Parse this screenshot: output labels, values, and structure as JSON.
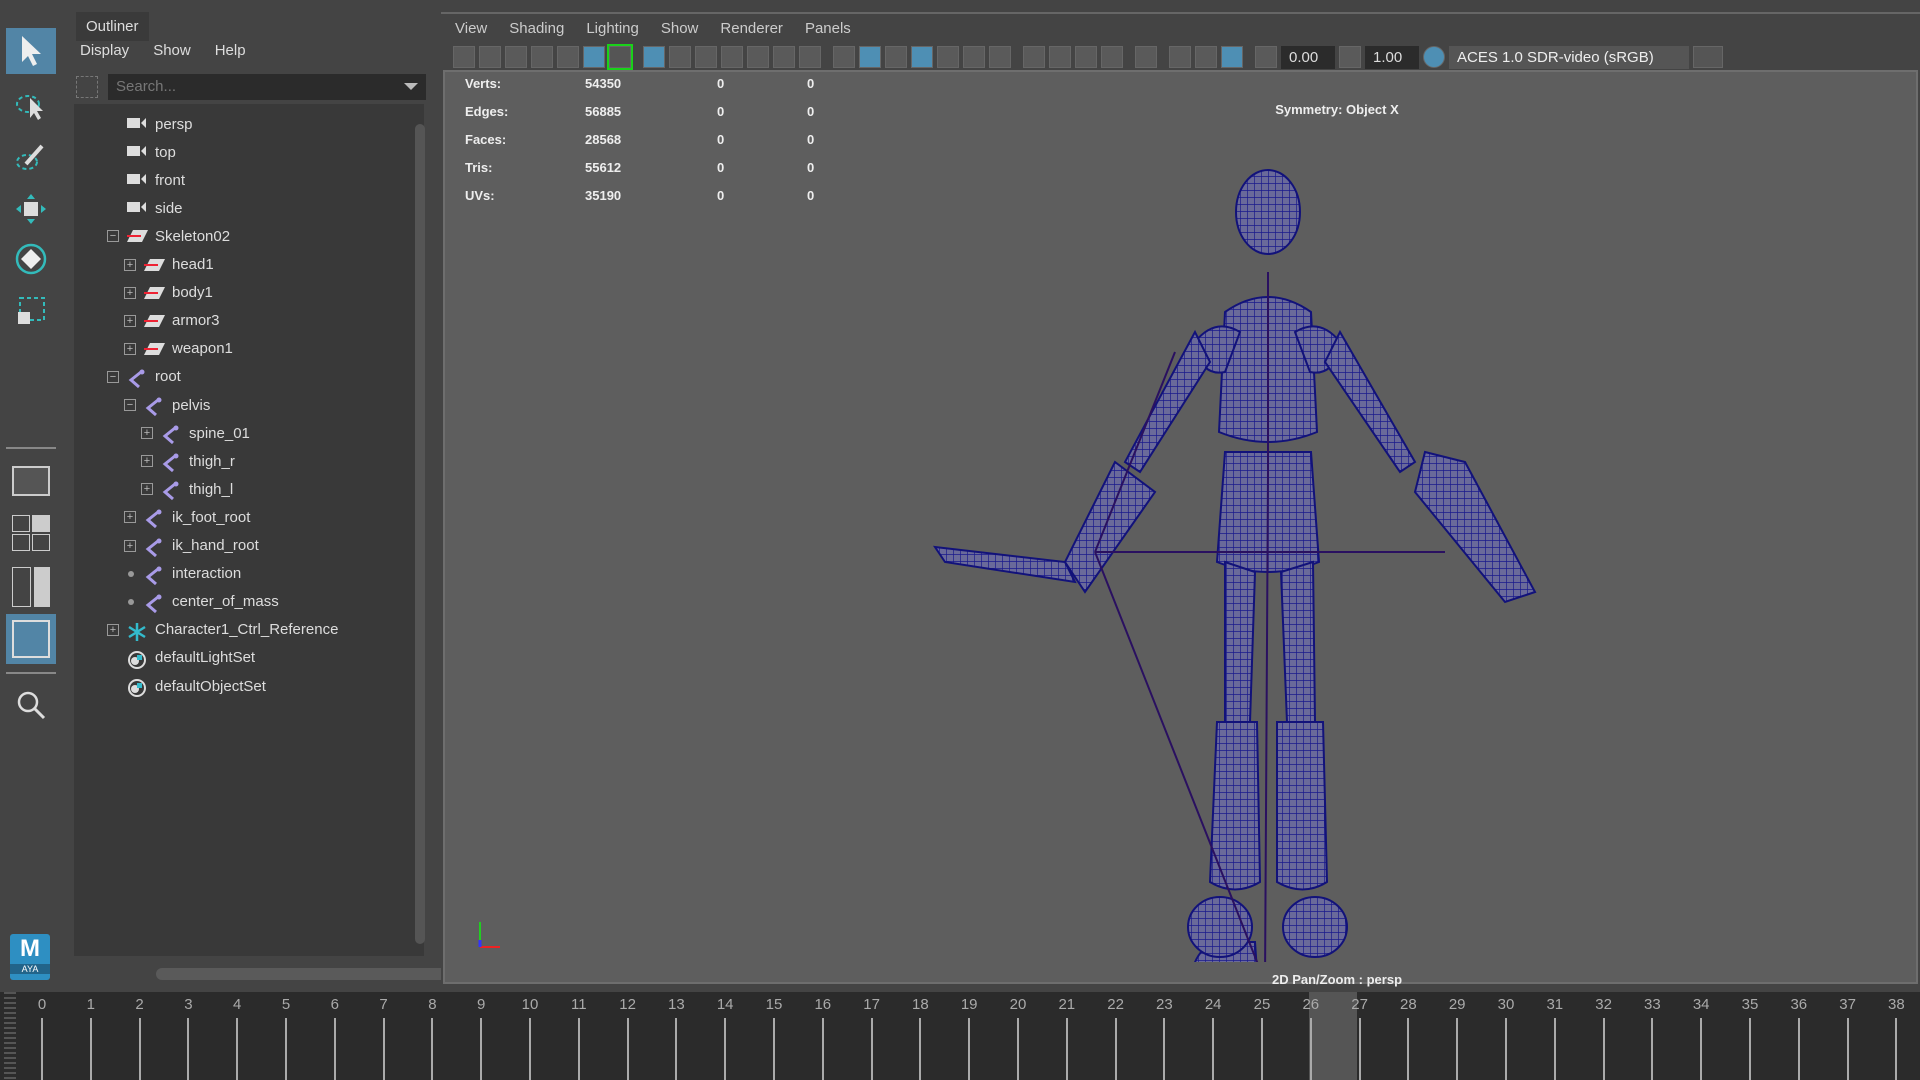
{
  "outliner": {
    "title": "Outliner",
    "menu": [
      "Display",
      "Show",
      "Help"
    ],
    "search_placeholder": "Search...",
    "items": [
      {
        "label": "persp",
        "icon": "camera",
        "level": 0,
        "exp": "none"
      },
      {
        "label": "top",
        "icon": "camera",
        "level": 0,
        "exp": "none"
      },
      {
        "label": "front",
        "icon": "camera",
        "level": 0,
        "exp": "none"
      },
      {
        "label": "side",
        "icon": "camera",
        "level": 0,
        "exp": "none"
      },
      {
        "label": "Skeleton02",
        "icon": "layer",
        "level": 0,
        "exp": "minus"
      },
      {
        "label": "head1",
        "icon": "layer",
        "level": 1,
        "exp": "plus"
      },
      {
        "label": "body1",
        "icon": "layer",
        "level": 1,
        "exp": "plus"
      },
      {
        "label": "armor3",
        "icon": "layer",
        "level": 1,
        "exp": "plus"
      },
      {
        "label": "weapon1",
        "icon": "layer",
        "level": 1,
        "exp": "plus"
      },
      {
        "label": "root",
        "icon": "joint",
        "level": 0,
        "exp": "minus"
      },
      {
        "label": "pelvis",
        "icon": "joint",
        "level": 1,
        "exp": "minus"
      },
      {
        "label": "spine_01",
        "icon": "joint",
        "level": 2,
        "exp": "plus"
      },
      {
        "label": "thigh_r",
        "icon": "joint",
        "level": 2,
        "exp": "plus"
      },
      {
        "label": "thigh_l",
        "icon": "joint",
        "level": 2,
        "exp": "plus"
      },
      {
        "label": "ik_foot_root",
        "icon": "joint",
        "level": 1,
        "exp": "plus"
      },
      {
        "label": "ik_hand_root",
        "icon": "joint",
        "level": 1,
        "exp": "plus"
      },
      {
        "label": "interaction",
        "icon": "joint",
        "level": 1,
        "exp": "dot"
      },
      {
        "label": "center_of_mass",
        "icon": "joint",
        "level": 1,
        "exp": "dot"
      },
      {
        "label": "Character1_Ctrl_Reference",
        "icon": "asterisk",
        "level": 0,
        "exp": "plus"
      },
      {
        "label": "defaultLightSet",
        "icon": "set",
        "level": 0,
        "exp": "none"
      },
      {
        "label": "defaultObjectSet",
        "icon": "set",
        "level": 0,
        "exp": "none"
      }
    ]
  },
  "viewport": {
    "menu": [
      "View",
      "Shading",
      "Lighting",
      "Show",
      "Renderer",
      "Panels"
    ],
    "exposure": "0.00",
    "gamma": "1.00",
    "color_space": "ACES 1.0 SDR-video (sRGB)",
    "stats": [
      {
        "label": "Verts:",
        "v": "54350",
        "a": "0",
        "b": "0"
      },
      {
        "label": "Edges:",
        "v": "56885",
        "a": "0",
        "b": "0"
      },
      {
        "label": "Faces:",
        "v": "28568",
        "a": "0",
        "b": "0"
      },
      {
        "label": "Tris:",
        "v": "55612",
        "a": "0",
        "b": "0"
      },
      {
        "label": "UVs:",
        "v": "35190",
        "a": "0",
        "b": "0"
      }
    ],
    "symmetry": "Symmetry: Object X",
    "status": "2D Pan/Zoom : persp"
  },
  "timeline": {
    "start": 0,
    "end": 38,
    "current": 26
  },
  "logo": "M AYA",
  "colors": {
    "accent": "#5285a6",
    "wire": "#1a1a8c"
  }
}
